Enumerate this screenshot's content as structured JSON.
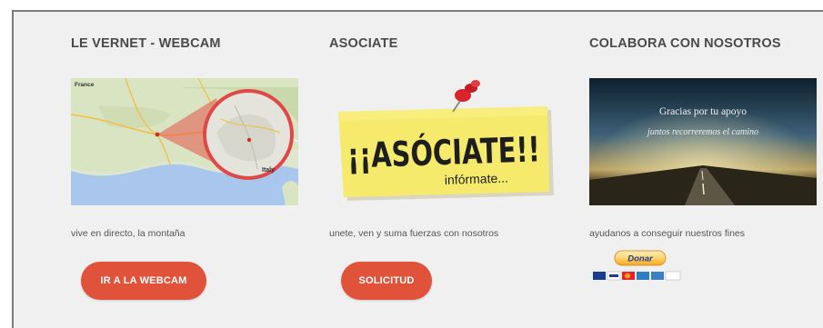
{
  "columns": [
    {
      "heading": "LE VERNET - WEBCAM",
      "image": {
        "map_labels": {
          "country_left": "France",
          "country_right": "Italy"
        }
      },
      "description": "vive en directo, la montaña",
      "button_label": "IR A LA WEBCAM"
    },
    {
      "heading": "ASOCIATE",
      "image": {
        "note_title": "¡¡ASÓCIATE!!",
        "note_subtitle": "infórmate..."
      },
      "description": "unete, ven y suma fuerzas con nosotros",
      "button_label": "SOLICITUD"
    },
    {
      "heading": "COLABORA CON NOSOTROS",
      "image": {
        "line1": "Gracias por tu apoyo",
        "line2": "juntos recorreremos el camino"
      },
      "description": "ayudanos a conseguir nuestros fines",
      "donate_label": "Donar"
    }
  ],
  "colors": {
    "button": "#e0533a",
    "heading": "#4a4a4a",
    "panel": "#f0f0f0"
  }
}
